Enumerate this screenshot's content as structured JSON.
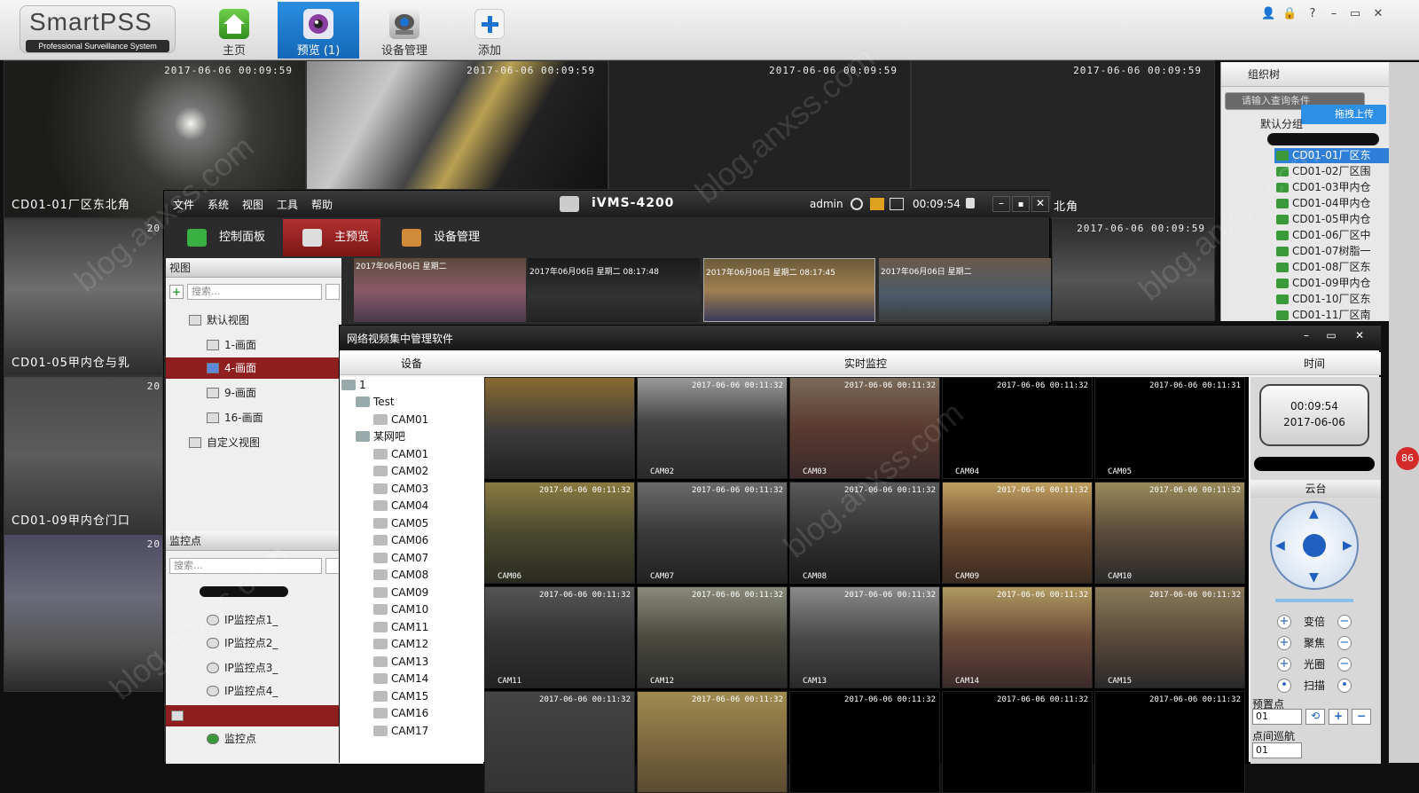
{
  "smartpss": {
    "logo_name": "SmartPSS",
    "logo_sub": "Professional Surveillance System",
    "nav": [
      {
        "label": "主页",
        "icon": "home-icon"
      },
      {
        "label": "预览 (1)",
        "icon": "camera-icon"
      },
      {
        "label": "设备管理",
        "icon": "device-manage-icon"
      },
      {
        "label": "添加",
        "icon": "add-icon"
      }
    ],
    "window_buttons": [
      "👤",
      "🔒",
      "?",
      "–",
      "▭",
      "✕"
    ],
    "tiles": [
      {
        "ts": "2017-06-06  00:09:59",
        "label": "CD01-01厂区东北角"
      },
      {
        "ts": "2017-06-06  00:09:59",
        "label": ""
      },
      {
        "ts": "2017-06-06  00:09:59",
        "label": ""
      },
      {
        "ts": "2017-06-06  00:09:59",
        "label": "北角"
      },
      {
        "ts": "20",
        "label": "CD01-05甲内仓与乳"
      },
      {
        "ts": "2017-06-06  00:09:59",
        "label": ""
      },
      {
        "ts": "20",
        "label": "CD01-09甲内仓门口"
      },
      {
        "ts": "20",
        "label": ""
      }
    ],
    "org": {
      "header": "组织树",
      "search_placeholder": "请输入查询条件",
      "upload": "拖拽上传",
      "group": "默认分组",
      "devices": [
        "CD01-01厂区东",
        "CD01-02厂区围",
        "CD01-03甲内仓",
        "CD01-04甲内仓",
        "CD01-05甲内仓",
        "CD01-06厂区中",
        "CD01-07树脂一",
        "CD01-08厂区东",
        "CD01-09甲内仓",
        "CD01-10厂区东",
        "CD01-11厂区南"
      ]
    },
    "badge": "86"
  },
  "ivms": {
    "menu": [
      "文件",
      "系统",
      "视图",
      "工具",
      "帮助"
    ],
    "title": "iVMS-4200",
    "user": "admin",
    "time": "00:09:54",
    "tabs": [
      "控制面板",
      "主预览",
      "设备管理"
    ],
    "thumb_labels": [
      "2017年06月06日 星期二",
      "2017年06月06日 星期二 08:17:48",
      "2017年06月06日 星期二 08:17:45",
      "2017年06月06日 星期二"
    ],
    "view_header": "视图",
    "search_placeholder": "搜索...",
    "views": [
      "默认视图",
      "1-画面",
      "4-画面",
      "9-画面",
      "16-画面",
      "自定义视图"
    ],
    "monitor_header": "监控点",
    "monitor_search": "搜索...",
    "monitors": [
      "IP监控点1_",
      "IP监控点2_",
      "IP监控点3_",
      "IP监控点4_",
      "监控点"
    ]
  },
  "nvcms": {
    "title": "网络视频集中管理软件",
    "col_device": "设备",
    "col_live": "实时监控",
    "col_time": "时间",
    "tree_root": "1",
    "tree_test": "Test",
    "tree_test_cam": "CAM01",
    "tree_cafe": "某网吧",
    "cams": [
      "CAM01",
      "CAM02",
      "CAM03",
      "CAM04",
      "CAM05",
      "CAM06",
      "CAM07",
      "CAM08",
      "CAM09",
      "CAM10",
      "CAM11",
      "CAM12",
      "CAM13",
      "CAM14",
      "CAM15",
      "CAM16",
      "CAM17"
    ],
    "grid": [
      {
        "ts": "",
        "name": ""
      },
      {
        "ts": "2017-06-06 00:11:32",
        "name": "CAM02"
      },
      {
        "ts": "2017-06-06 00:11:32",
        "name": "CAM03"
      },
      {
        "ts": "2017-06-06 00:11:32",
        "name": "CAM04"
      },
      {
        "ts": "2017-06-06 00:11:31",
        "name": "CAM05"
      },
      {
        "ts": "2017-06-06 00:11:32",
        "name": "CAM06"
      },
      {
        "ts": "2017-06-06 00:11:32",
        "name": "CAM07"
      },
      {
        "ts": "2017-06-06 00:11:32",
        "name": "CAM08"
      },
      {
        "ts": "2017-06-06 00:11:32",
        "name": "CAM09"
      },
      {
        "ts": "2017-06-06 00:11:32",
        "name": "CAM10"
      },
      {
        "ts": "2017-06-06 00:11:32",
        "name": "CAM11"
      },
      {
        "ts": "2017-06-06 00:11:32",
        "name": "CAM12"
      },
      {
        "ts": "2017-06-06 00:11:32",
        "name": "CAM13"
      },
      {
        "ts": "2017-06-06 00:11:32",
        "name": "CAM14"
      },
      {
        "ts": "2017-06-06 00:11:32",
        "name": "CAM15"
      },
      {
        "ts": "2017-06-06 00:11:32",
        "name": ""
      },
      {
        "ts": "2017-06-06 00:11:32",
        "name": ""
      },
      {
        "ts": "2017-06-06 00:11:32",
        "name": ""
      },
      {
        "ts": "2017-06-06 00:11:32",
        "name": ""
      },
      {
        "ts": "2017-06-06 00:11:32",
        "name": ""
      }
    ],
    "clock_time": "00:09:54",
    "clock_date": "2017-06-06",
    "ptz_header": "云台",
    "ptz_rows": [
      "变倍",
      "聚焦",
      "光圈",
      "扫描"
    ],
    "preset_label": "预置点",
    "preset_value": "01",
    "patrol_label": "点间巡航",
    "patrol_value": "01"
  },
  "colors": {
    "accent_blue": "#1567b8",
    "ivms_red": "#8f1f1f",
    "selection_blue": "#2f7fd8"
  }
}
